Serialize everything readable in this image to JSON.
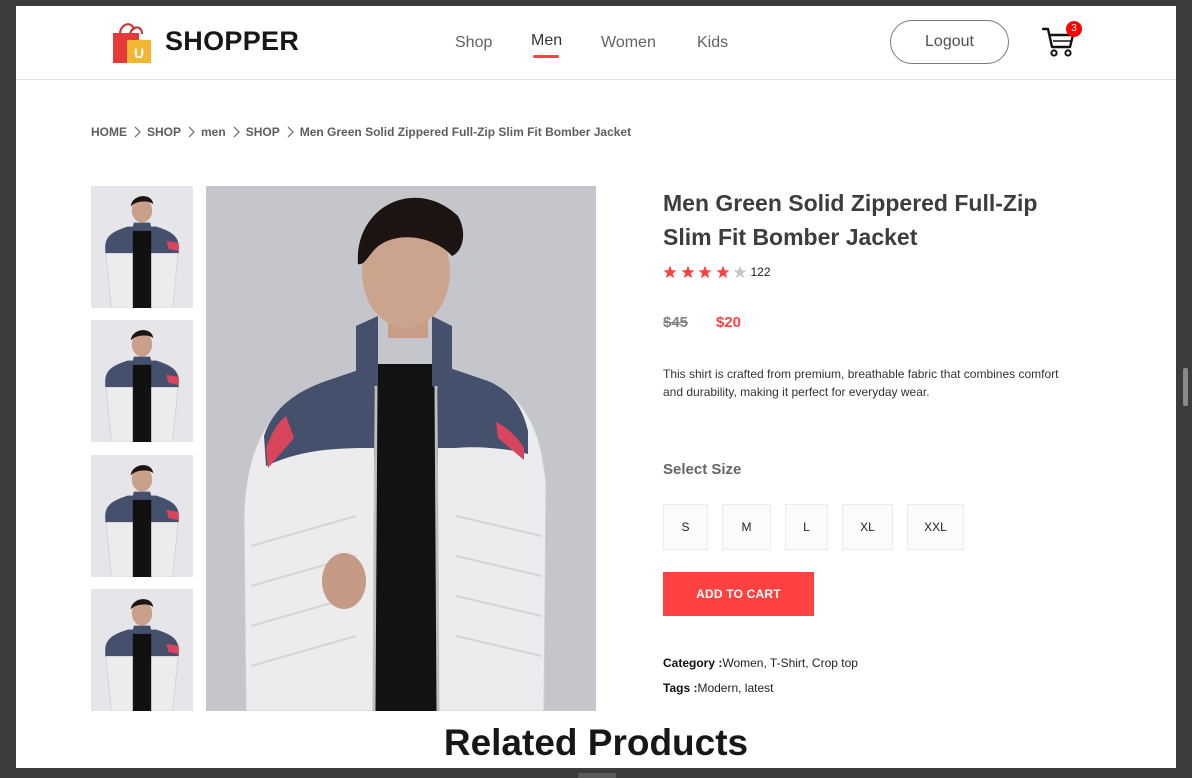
{
  "brand": {
    "name": "SHOPPER",
    "logo_letter": "U"
  },
  "nav": {
    "items": [
      {
        "label": "Shop",
        "active": false
      },
      {
        "label": "Men",
        "active": true
      },
      {
        "label": "Women",
        "active": false
      },
      {
        "label": "Kids",
        "active": false
      }
    ],
    "logout_label": "Logout",
    "cart_count": "3"
  },
  "breadcrumb": [
    "HOME",
    "SHOP",
    "men",
    "SHOP",
    "Men Green Solid Zippered Full-Zip Slim Fit Bomber Jacket"
  ],
  "product": {
    "title": "Men Green Solid Zippered Full-Zip Slim Fit Bomber Jacket",
    "rating_stars": 4,
    "rating_max": 5,
    "rating_count": "122",
    "old_price": "$45",
    "new_price": "$20",
    "description": "This shirt is crafted from premium, breathable fabric that combines comfort and durability, making it perfect for everyday wear.",
    "select_size_label": "Select Size",
    "sizes": [
      "S",
      "M",
      "L",
      "XL",
      "XXL"
    ],
    "add_to_cart_label": "ADD TO CART",
    "category_label": "Category :",
    "category_value": "Women, T-Shirt, Crop top",
    "tags_label": "Tags :",
    "tags_value": "Modern, latest"
  },
  "related": {
    "title": "Related Products"
  },
  "colors": {
    "accent": "#ff4141",
    "badge": "#ff0000",
    "star": "#ff4141",
    "star_empty": "#c8c8c8",
    "jacket_white": "#ececee",
    "jacket_navy": "#44506c",
    "jacket_red_stripe": "#d9455c",
    "photo_background": "#c5c6cc"
  },
  "icons": {
    "logo": "shopping-bag-icon",
    "cart": "cart-icon",
    "breadcrumb_separator": "chevron-right-icon",
    "star": "star-icon"
  }
}
